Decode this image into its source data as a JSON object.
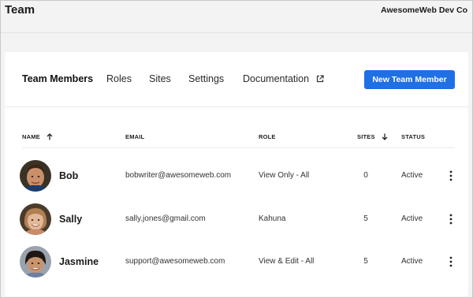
{
  "header": {
    "title": "Team",
    "org": "AwesomeWeb Dev Co"
  },
  "tabs": [
    {
      "label": "Team Members"
    },
    {
      "label": "Roles"
    },
    {
      "label": "Sites"
    },
    {
      "label": "Settings"
    },
    {
      "label": "Documentation"
    }
  ],
  "actions": {
    "new_member": "New Team Member"
  },
  "table": {
    "columns": {
      "name": "NAME",
      "email": "EMAIL",
      "role": "ROLE",
      "sites": "SITES",
      "status": "STATUS"
    },
    "rows": [
      {
        "name": "Bob",
        "email": "bobwriter@awesomeweb.com",
        "role": "View Only - All",
        "sites": "0",
        "status": "Active"
      },
      {
        "name": "Sally",
        "email": "sally.jones@gmail.com",
        "role": "Kahuna",
        "sites": "5",
        "status": "Active"
      },
      {
        "name": "Jasmine",
        "email": "support@awesomeweb.com",
        "role": "View & Edit - All",
        "sites": "5",
        "status": "Active"
      }
    ]
  },
  "colors": {
    "primary": "#1f6fe5",
    "background": "#f3f3f3",
    "card": "#ffffff"
  },
  "icons": {
    "external": "external-link-icon",
    "sort_up": "arrow-up-icon",
    "sort_down": "arrow-down-icon",
    "menu": "kebab-menu-icon"
  }
}
